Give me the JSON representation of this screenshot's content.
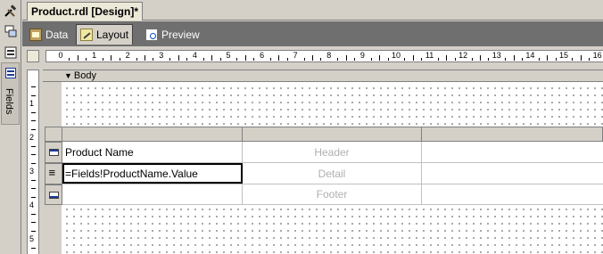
{
  "document_tab": {
    "title": "Product.rdl [Design]*"
  },
  "side_panel": {
    "fields_label": "Fields",
    "tools_icon": "hammer-icon",
    "server_icon": "server-explorer-icon",
    "toolbox_icon": "toolbox-icon",
    "fields_icon": "fields-list-icon"
  },
  "subtabs": [
    {
      "label": "Data",
      "icon": "data-tab-icon"
    },
    {
      "label": "Layout",
      "icon": "layout-tab-icon",
      "active": true
    },
    {
      "label": "Preview",
      "icon": "preview-tab-icon"
    }
  ],
  "ruler": {
    "horizontal": [
      "0",
      "1",
      "2",
      "3",
      "4",
      "5",
      "6",
      "7",
      "8",
      "9",
      "10",
      "11",
      "12",
      "13",
      "14",
      "15",
      "16"
    ],
    "vertical": [
      "1",
      "2",
      "3",
      "4",
      "5"
    ]
  },
  "body_section": {
    "label": "Body"
  },
  "table": {
    "rows": [
      {
        "type": "header",
        "cells": [
          "Product Name",
          "Header",
          ""
        ]
      },
      {
        "type": "detail",
        "cells": [
          "=Fields!ProductName.Value",
          "Detail",
          ""
        ]
      },
      {
        "type": "footer",
        "cells": [
          "",
          "Footer",
          ""
        ]
      }
    ]
  },
  "colors": {
    "selection": "#000000",
    "ghost_text": "#b0b0b0",
    "tabbar": "#6f6f6f"
  }
}
